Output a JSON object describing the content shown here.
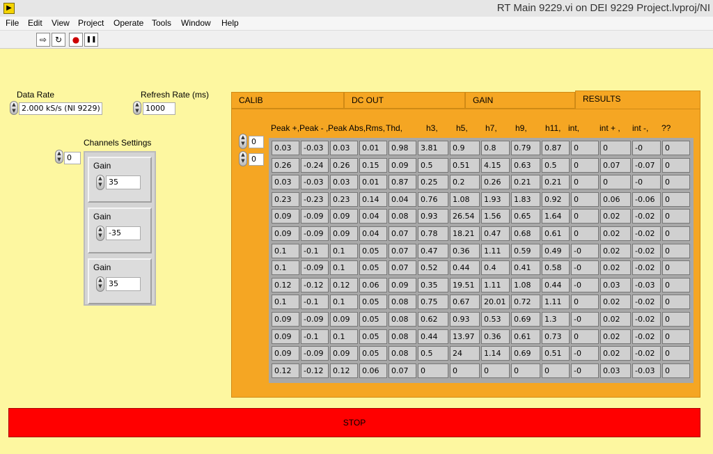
{
  "window": {
    "title": "RT Main 9229.vi on DEI 9229 Project.lvproj/NI"
  },
  "menu": [
    "File",
    "Edit",
    "View",
    "Project",
    "Operate",
    "Tools",
    "Window",
    "Help"
  ],
  "toolbar": {
    "run": "⇨",
    "run_continuous": "↻",
    "abort": "●",
    "pause": "❚❚"
  },
  "data_rate": {
    "label": "Data Rate",
    "value": "2.000 kS/s (NI 9229)"
  },
  "refresh_rate": {
    "label": "Refresh Rate (ms)",
    "value": "1000"
  },
  "channels": {
    "label": "Channels Settings",
    "index": "0",
    "items": [
      {
        "label": "Gain",
        "value": "35"
      },
      {
        "label": "Gain",
        "value": "-35"
      },
      {
        "label": "Gain",
        "value": "35"
      }
    ]
  },
  "tabs": [
    "CALIB",
    "DC OUT",
    "GAIN",
    "RESULTS"
  ],
  "results": {
    "row_index": "0",
    "col_index": "0",
    "headers": [
      "Peak +,",
      "Peak - ,",
      "Peak Abs,",
      "Rms,",
      "Thd,",
      "h3,",
      "h5,",
      "h7,",
      "h9,",
      "h11,",
      "int,",
      "int + ,",
      "int -,",
      "??"
    ],
    "rows": [
      [
        "0.03",
        "-0.03",
        "0.03",
        "0.01",
        "0.98",
        "3.81",
        "0.9",
        "0.8",
        "0.79",
        "0.87",
        "0",
        "0",
        "-0",
        "0"
      ],
      [
        "0.26",
        "-0.24",
        "0.26",
        "0.15",
        "0.09",
        "0.5",
        "0.51",
        "4.15",
        "0.63",
        "0.5",
        "0",
        "0.07",
        "-0.07",
        "0"
      ],
      [
        "0.03",
        "-0.03",
        "0.03",
        "0.01",
        "0.87",
        "0.25",
        "0.2",
        "0.26",
        "0.21",
        "0.21",
        "0",
        "0",
        "-0",
        "0"
      ],
      [
        "0.23",
        "-0.23",
        "0.23",
        "0.14",
        "0.04",
        "0.76",
        "1.08",
        "1.93",
        "1.83",
        "0.92",
        "0",
        "0.06",
        "-0.06",
        "0"
      ],
      [
        "0.09",
        "-0.09",
        "0.09",
        "0.04",
        "0.08",
        "0.93",
        "26.54",
        "1.56",
        "0.65",
        "1.64",
        "0",
        "0.02",
        "-0.02",
        "0"
      ],
      [
        "0.09",
        "-0.09",
        "0.09",
        "0.04",
        "0.07",
        "0.78",
        "18.21",
        "0.47",
        "0.68",
        "0.61",
        "0",
        "0.02",
        "-0.02",
        "0"
      ],
      [
        "0.1",
        "-0.1",
        "0.1",
        "0.05",
        "0.07",
        "0.47",
        "0.36",
        "1.11",
        "0.59",
        "0.49",
        "-0",
        "0.02",
        "-0.02",
        "0"
      ],
      [
        "0.1",
        "-0.09",
        "0.1",
        "0.05",
        "0.07",
        "0.52",
        "0.44",
        "0.4",
        "0.41",
        "0.58",
        "-0",
        "0.02",
        "-0.02",
        "0"
      ],
      [
        "0.12",
        "-0.12",
        "0.12",
        "0.06",
        "0.09",
        "0.35",
        "19.51",
        "1.11",
        "1.08",
        "0.44",
        "-0",
        "0.03",
        "-0.03",
        "0"
      ],
      [
        "0.1",
        "-0.1",
        "0.1",
        "0.05",
        "0.08",
        "0.75",
        "0.67",
        "20.01",
        "0.72",
        "1.11",
        "0",
        "0.02",
        "-0.02",
        "0"
      ],
      [
        "0.09",
        "-0.09",
        "0.09",
        "0.05",
        "0.08",
        "0.62",
        "0.93",
        "0.53",
        "0.69",
        "1.3",
        "-0",
        "0.02",
        "-0.02",
        "0"
      ],
      [
        "0.09",
        "-0.1",
        "0.1",
        "0.05",
        "0.08",
        "0.44",
        "13.97",
        "0.36",
        "0.61",
        "0.73",
        "0",
        "0.02",
        "-0.02",
        "0"
      ],
      [
        "0.09",
        "-0.09",
        "0.09",
        "0.05",
        "0.08",
        "0.5",
        "24",
        "1.14",
        "0.69",
        "0.51",
        "-0",
        "0.02",
        "-0.02",
        "0"
      ],
      [
        "0.12",
        "-0.12",
        "0.12",
        "0.06",
        "0.07",
        "0",
        "0",
        "0",
        "0",
        "0",
        "-0",
        "0.03",
        "-0.03",
        "0"
      ]
    ]
  },
  "stop_button": {
    "label": "STOP"
  }
}
